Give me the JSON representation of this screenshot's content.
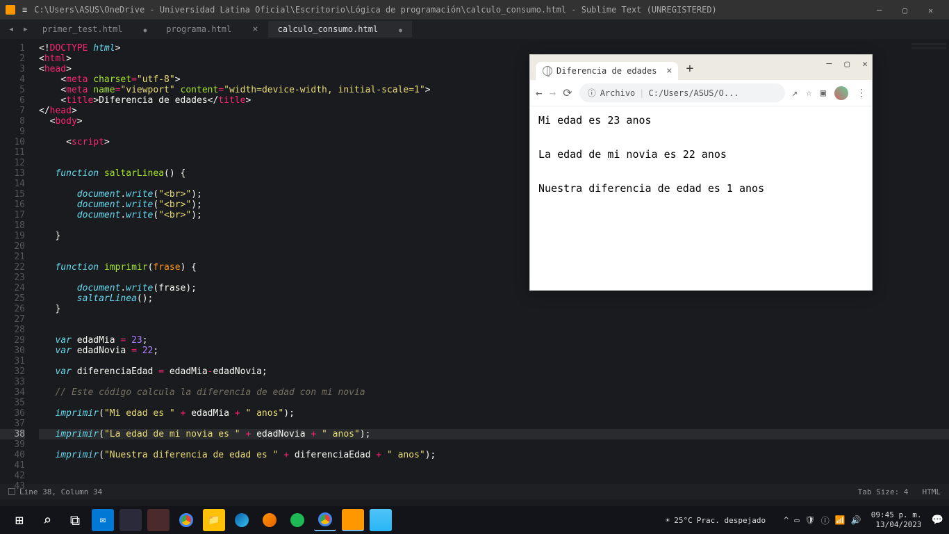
{
  "titlebar": {
    "path": "C:\\Users\\ASUS\\OneDrive - Universidad Latina Oficial\\Escritorio\\Lógica de programación\\calculo_consumo.html - Sublime Text (UNREGISTERED)"
  },
  "tabs": [
    {
      "label": "primer_test.html",
      "active": false,
      "dirty": true
    },
    {
      "label": "programa.html",
      "active": false,
      "dirty": false
    },
    {
      "label": "calculo_consumo.html",
      "active": true,
      "dirty": true
    }
  ],
  "code": {
    "lines": 43,
    "active_line": 38
  },
  "statusbar": {
    "left": "Line 38, Column 34",
    "tabsize": "Tab Size: 4",
    "syntax": "HTML"
  },
  "chrome": {
    "tab_title": "Diferencia de edades",
    "addr_label": "Archivo",
    "addr_path": "C:/Users/ASUS/O...",
    "body": [
      "Mi edad es 23 anos",
      "La edad de mi novia es 22 anos",
      "Nuestra diferencia de edad es 1 anos"
    ]
  },
  "taskbar": {
    "weather_temp": "25°C",
    "weather_text": "Prac. despejado",
    "time": "09:45 p. m.",
    "date": "13/04/2023"
  }
}
